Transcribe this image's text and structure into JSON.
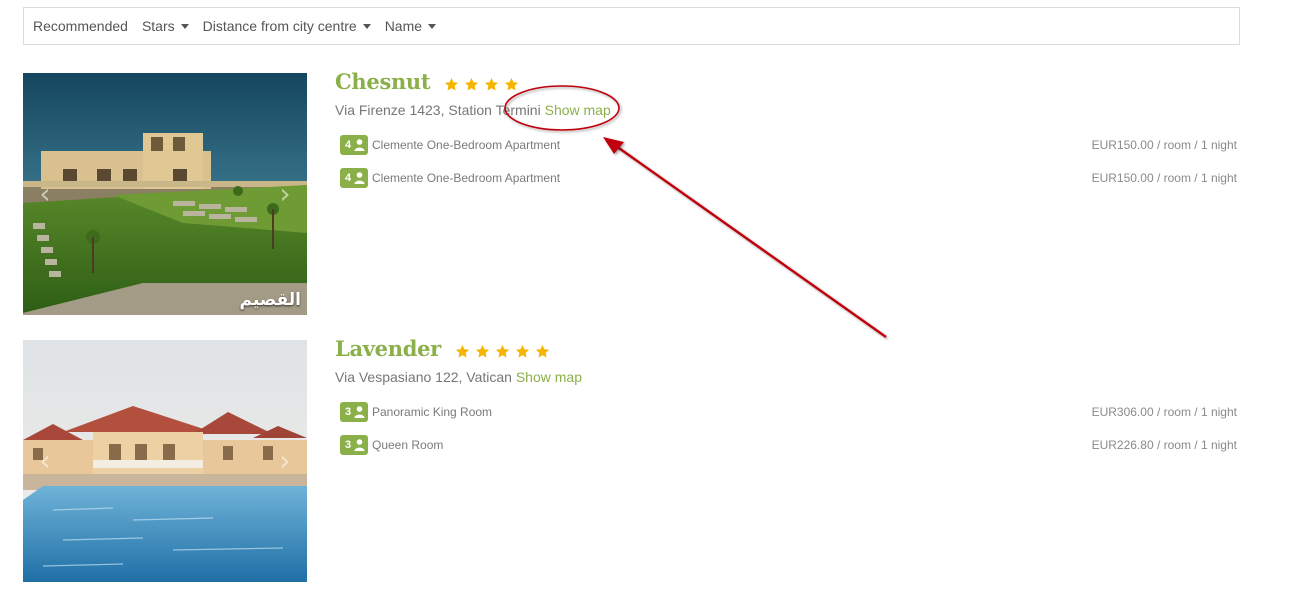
{
  "filters": {
    "recommended": "Recommended",
    "stars": "Stars",
    "distance": "Distance from city centre",
    "name": "Name"
  },
  "colors": {
    "accent": "#8bb04a",
    "star": "#f5b400",
    "annotation": "#c0000b"
  },
  "hotels": [
    {
      "name": "Chesnut",
      "stars": 4,
      "address": "Via Firenze 1423, Station Termini",
      "show_map": "Show map",
      "photo_caption": "القصيم",
      "rooms": [
        {
          "guests": "4",
          "name": "Clemente One-Bedroom Apartment",
          "price": "EUR150.00 / room / 1 night"
        },
        {
          "guests": "4",
          "name": "Clemente One-Bedroom Apartment",
          "price": "EUR150.00 / room / 1 night"
        }
      ]
    },
    {
      "name": "Lavender",
      "stars": 5,
      "address": "Via Vespasiano 122, Vatican",
      "show_map": "Show map",
      "rooms": [
        {
          "guests": "3",
          "name": "Panoramic King Room",
          "price": "EUR306.00 / room / 1 night"
        },
        {
          "guests": "3",
          "name": "Queen Room",
          "price": "EUR226.80 / room / 1 night"
        }
      ]
    }
  ]
}
